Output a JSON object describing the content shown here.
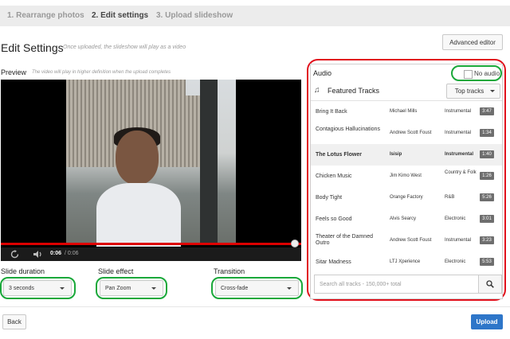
{
  "steps": [
    {
      "label": "1. Rearrange photos"
    },
    {
      "label": "2. Edit settings"
    },
    {
      "label": "3. Upload slideshow"
    }
  ],
  "page": {
    "title": "Edit Settings",
    "subtitle": "Once uploaded, the slideshow will play as a video",
    "advanced_editor": "Advanced editor"
  },
  "preview": {
    "label": "Preview",
    "note": "The video will play in higher definition when the upload completes",
    "time_current": "0:06",
    "time_total": "/ 0:06",
    "progress": 1.0
  },
  "settings": {
    "duration_label": "Slide duration",
    "duration_value": "3 seconds",
    "effect_label": "Slide effect",
    "effect_value": "Pan Zoom",
    "transition_label": "Transition",
    "transition_value": "Cross-fade"
  },
  "audio": {
    "title": "Audio",
    "no_audio": "No audio",
    "featured": "Featured Tracks",
    "sort": "Top tracks",
    "search_placeholder": "Search all tracks - 150,000+ total",
    "tracks": [
      {
        "name": "Bring It Back",
        "artist": "Michael Mills",
        "genre": "Instrumental",
        "duration": "3:47"
      },
      {
        "name": "Contagious Hallucinations",
        "artist": "Andrew Scott Foust",
        "genre": "Instrumental",
        "duration": "1:34"
      },
      {
        "name": "The Lotus Flower",
        "artist": "Isisip",
        "genre": "Instrumental",
        "duration": "1:40"
      },
      {
        "name": "Chicken Music",
        "artist": "Jim Kimo West",
        "genre": "Country & Folk",
        "duration": "1:26"
      },
      {
        "name": "Body Tight",
        "artist": "Orange Factory",
        "genre": "R&B",
        "duration": "5:26"
      },
      {
        "name": "Feels so Good",
        "artist": "Alvis Searcy",
        "genre": "Electronic",
        "duration": "3:01"
      },
      {
        "name": "Theater of the Damned Outro",
        "artist": "Andrew Scott Foust",
        "genre": "Instrumental",
        "duration": "3:23"
      },
      {
        "name": "Sitar Madness",
        "artist": "LTJ Xperience",
        "genre": "Electronic",
        "duration": "5:53"
      }
    ]
  },
  "footer": {
    "back": "Back",
    "upload": "Upload"
  },
  "colors": {
    "accent": "#2e76c9",
    "progress": "#dd0000",
    "highlight_green": "#1aa83a",
    "highlight_red": "#e1111c"
  }
}
